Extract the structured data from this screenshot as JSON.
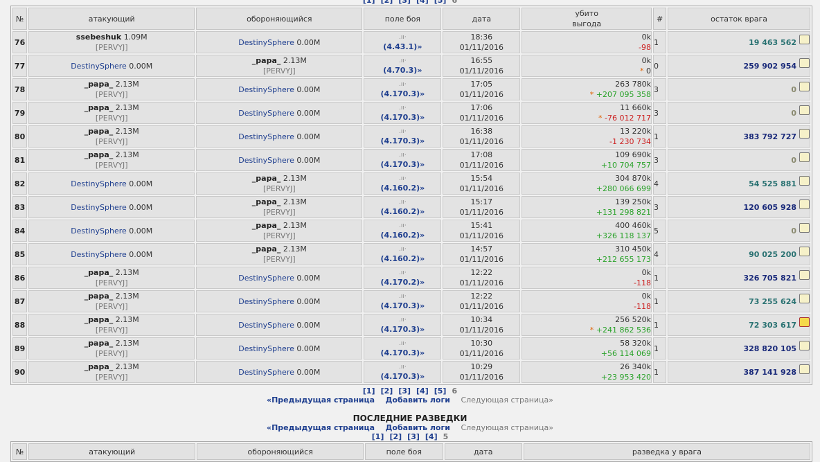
{
  "top_pager": [
    "[1]",
    "[2]",
    "[3]",
    "[4]",
    "[5]",
    "6"
  ],
  "headers": {
    "num": "№",
    "attacker": "атакующий",
    "defender": "обороняющийся",
    "field": "поле боя",
    "date": "дата",
    "killed": "убито",
    "profit": "выгода",
    "rounds": "#",
    "remaining": "остаток врага"
  },
  "rows": [
    {
      "num": "76",
      "att_name": "ssebeshuk",
      "att_size": "1.09M",
      "att_all": "[PERVYJ]",
      "def_name": "DestinySphere",
      "def_size": "0.00M",
      "def_all": "",
      "coord": "(4.43.1)»",
      "time": "18:36",
      "date": "01/11/2016",
      "killed": "0k",
      "star": "",
      "profit": "-98",
      "profit_type": "neg",
      "rounds": "1",
      "remaining": "19 463 562",
      "rem_type": "teal",
      "active": false,
      "att_link": false
    },
    {
      "num": "77",
      "att_name": "DestinySphere",
      "att_size": "0.00M",
      "att_all": "",
      "def_name": "_papa_",
      "def_size": "2.13M",
      "def_all": "[PERVYJ]",
      "coord": "(4.70.3)»",
      "time": "16:55",
      "date": "01/11/2016",
      "killed": "0k",
      "star": "* ",
      "profit": "0",
      "profit_type": "plain",
      "rounds": "0",
      "remaining": "259 902 954",
      "rem_type": "blue",
      "active": false,
      "att_link": true
    },
    {
      "num": "78",
      "att_name": "_papa_",
      "att_size": "2.13M",
      "att_all": "[PERVYJ]",
      "def_name": "DestinySphere",
      "def_size": "0.00M",
      "def_all": "",
      "coord": "(4.170.3)»",
      "time": "17:05",
      "date": "01/11/2016",
      "killed": "263 780k",
      "star": "* ",
      "profit": "+207 095 358",
      "profit_type": "pos",
      "rounds": "3",
      "remaining": "0",
      "rem_type": "zero",
      "active": false,
      "att_link": false
    },
    {
      "num": "79",
      "att_name": "_papa_",
      "att_size": "2.13M",
      "att_all": "[PERVYJ]",
      "def_name": "DestinySphere",
      "def_size": "0.00M",
      "def_all": "",
      "coord": "(4.170.3)»",
      "time": "17:06",
      "date": "01/11/2016",
      "killed": "11 660k",
      "star": "* ",
      "profit": "-76 012 717",
      "profit_type": "neg",
      "rounds": "3",
      "remaining": "0",
      "rem_type": "zero",
      "active": false,
      "att_link": false
    },
    {
      "num": "80",
      "att_name": "_papa_",
      "att_size": "2.13M",
      "att_all": "[PERVYJ]",
      "def_name": "DestinySphere",
      "def_size": "0.00M",
      "def_all": "",
      "coord": "(4.170.3)»",
      "time": "16:38",
      "date": "01/11/2016",
      "killed": "13 220k",
      "star": "",
      "profit": "-1 230 734",
      "profit_type": "neg",
      "rounds": "1",
      "remaining": "383 792 727",
      "rem_type": "blue",
      "active": false,
      "att_link": false
    },
    {
      "num": "81",
      "att_name": "_papa_",
      "att_size": "2.13M",
      "att_all": "[PERVYJ]",
      "def_name": "DestinySphere",
      "def_size": "0.00M",
      "def_all": "",
      "coord": "(4.170.3)»",
      "time": "17:08",
      "date": "01/11/2016",
      "killed": "109 690k",
      "star": "",
      "profit": "+10 704 757",
      "profit_type": "pos",
      "rounds": "3",
      "remaining": "0",
      "rem_type": "zero",
      "active": false,
      "att_link": false
    },
    {
      "num": "82",
      "att_name": "DestinySphere",
      "att_size": "0.00M",
      "att_all": "",
      "def_name": "_papa_",
      "def_size": "2.13M",
      "def_all": "[PERVYJ]",
      "coord": "(4.160.2)»",
      "time": "15:54",
      "date": "01/11/2016",
      "killed": "304 870k",
      "star": "",
      "profit": "+280 066 699",
      "profit_type": "pos",
      "rounds": "4",
      "remaining": "54 525 881",
      "rem_type": "teal",
      "active": false,
      "att_link": true
    },
    {
      "num": "83",
      "att_name": "DestinySphere",
      "att_size": "0.00M",
      "att_all": "",
      "def_name": "_papa_",
      "def_size": "2.13M",
      "def_all": "[PERVYJ]",
      "coord": "(4.160.2)»",
      "time": "15:17",
      "date": "01/11/2016",
      "killed": "139 250k",
      "star": "",
      "profit": "+131 298 821",
      "profit_type": "pos",
      "rounds": "3",
      "remaining": "120 605 928",
      "rem_type": "blue",
      "active": false,
      "att_link": true
    },
    {
      "num": "84",
      "att_name": "DestinySphere",
      "att_size": "0.00M",
      "att_all": "",
      "def_name": "_papa_",
      "def_size": "2.13M",
      "def_all": "[PERVYJ]",
      "coord": "(4.160.2)»",
      "time": "15:41",
      "date": "01/11/2016",
      "killed": "400 460k",
      "star": "",
      "profit": "+326 118 137",
      "profit_type": "pos",
      "rounds": "5",
      "remaining": "0",
      "rem_type": "zero",
      "active": false,
      "att_link": true
    },
    {
      "num": "85",
      "att_name": "DestinySphere",
      "att_size": "0.00M",
      "att_all": "",
      "def_name": "_papa_",
      "def_size": "2.13M",
      "def_all": "[PERVYJ]",
      "coord": "(4.160.2)»",
      "time": "14:57",
      "date": "01/11/2016",
      "killed": "310 450k",
      "star": "",
      "profit": "+212 655 173",
      "profit_type": "pos",
      "rounds": "4",
      "remaining": "90 025 200",
      "rem_type": "teal",
      "active": false,
      "att_link": true
    },
    {
      "num": "86",
      "att_name": "_papa_",
      "att_size": "2.13M",
      "att_all": "[PERVYJ]",
      "def_name": "DestinySphere",
      "def_size": "0.00M",
      "def_all": "",
      "coord": "(4.170.2)»",
      "time": "12:22",
      "date": "01/11/2016",
      "killed": "0k",
      "star": "",
      "profit": "-118",
      "profit_type": "neg",
      "rounds": "1",
      "remaining": "326 705 821",
      "rem_type": "blue",
      "active": false,
      "att_link": false
    },
    {
      "num": "87",
      "att_name": "_papa_",
      "att_size": "2.13M",
      "att_all": "[PERVYJ]",
      "def_name": "DestinySphere",
      "def_size": "0.00M",
      "def_all": "",
      "coord": "(4.170.3)»",
      "time": "12:22",
      "date": "01/11/2016",
      "killed": "0k",
      "star": "",
      "profit": "-118",
      "profit_type": "neg",
      "rounds": "1",
      "remaining": "73 255 624",
      "rem_type": "teal",
      "active": false,
      "att_link": false
    },
    {
      "num": "88",
      "att_name": "_papa_",
      "att_size": "2.13M",
      "att_all": "[PERVYJ]",
      "def_name": "DestinySphere",
      "def_size": "0.00M",
      "def_all": "",
      "coord": "(4.170.3)»",
      "time": "10:34",
      "date": "01/11/2016",
      "killed": "256 520k",
      "star": "* ",
      "profit": "+241 862 536",
      "profit_type": "pos",
      "rounds": "1",
      "remaining": "72 303 617",
      "rem_type": "teal",
      "active": true,
      "att_link": false
    },
    {
      "num": "89",
      "att_name": "_papa_",
      "att_size": "2.13M",
      "att_all": "[PERVYJ]",
      "def_name": "DestinySphere",
      "def_size": "0.00M",
      "def_all": "",
      "coord": "(4.170.3)»",
      "time": "10:30",
      "date": "01/11/2016",
      "killed": "58 320k",
      "star": "",
      "profit": "+56 114 069",
      "profit_type": "pos",
      "rounds": "1",
      "remaining": "328 820 105",
      "rem_type": "blue",
      "active": false,
      "att_link": false
    },
    {
      "num": "90",
      "att_name": "_papa_",
      "att_size": "2.13M",
      "att_all": "[PERVYJ]",
      "def_name": "DestinySphere",
      "def_size": "0.00M",
      "def_all": "",
      "coord": "(4.170.3)»",
      "time": "10:29",
      "date": "01/11/2016",
      "killed": "26 340k",
      "star": "",
      "profit": "+23 953 420",
      "profit_type": "pos",
      "rounds": "1",
      "remaining": "387 141 928",
      "rem_type": "blue",
      "active": false,
      "att_link": false
    }
  ],
  "bottom_pager": [
    "[1]",
    "[2]",
    "[3]",
    "[4]",
    "[5]",
    "6"
  ],
  "nav": {
    "prev": "«Предыдущая страница",
    "add_logs": "Добавить логи",
    "next": "Следующая страница»"
  },
  "recon_section": {
    "title": "ПОСЛЕДНИЕ РАЗВЕДКИ",
    "pager": [
      "[1]",
      "[2]",
      "[3]",
      "[4]",
      "5"
    ],
    "headers": [
      "№",
      "атакующий",
      "обороняющийся",
      "поле боя",
      "дата",
      "разведка у врага"
    ]
  },
  "colors": {
    "link": "#1f3f8f",
    "positive": "#2aa22a",
    "negative": "#cc2222",
    "remaining_blue": "#1a2a7a",
    "remaining_teal": "#2a7272"
  },
  "icons": {
    "field": "battle-field-icon",
    "log": "scroll-log-icon"
  }
}
